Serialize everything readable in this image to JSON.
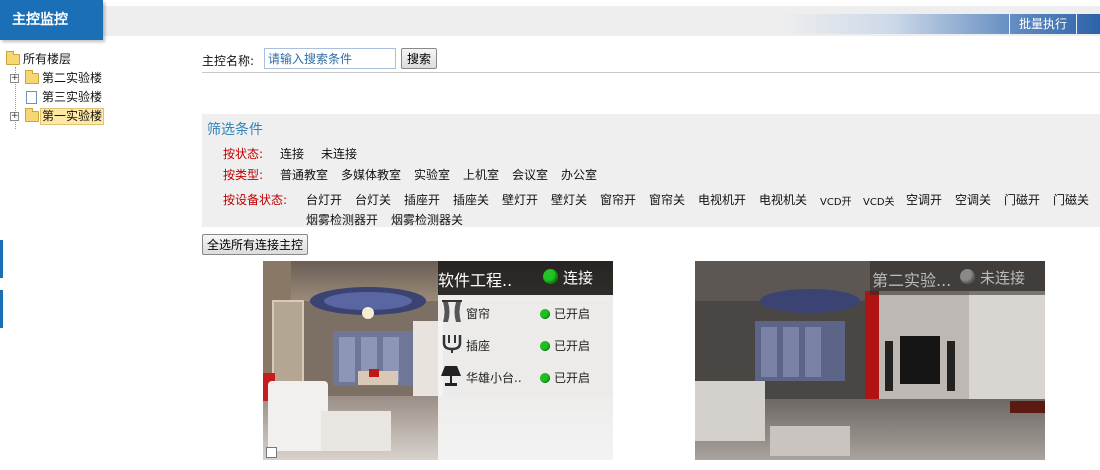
{
  "header": {
    "title": "主控监控",
    "batch_label": "批量执行"
  },
  "tree": {
    "root": "所有楼层",
    "items": [
      {
        "label": "第二实验楼",
        "expandable": true,
        "selected": false
      },
      {
        "label": "第三实验楼",
        "expandable": false,
        "selected": false
      },
      {
        "label": "第一实验楼",
        "expandable": true,
        "selected": true
      }
    ]
  },
  "search": {
    "label": "主控名称:",
    "value": "请输入搜索条件",
    "button": "搜索"
  },
  "filter": {
    "title": "筛选条件",
    "status_label": "按状态:",
    "status_options": [
      "连接",
      "未连接"
    ],
    "type_label": "按类型:",
    "type_options": [
      "普通教室",
      "多媒体教室",
      "实验室",
      "上机室",
      "会议室",
      "办公室"
    ],
    "device_label": "按设备状态:",
    "device_options": [
      "台灯开",
      "台灯关",
      "插座开",
      "插座关",
      "壁灯开",
      "壁灯关",
      "窗帘开",
      "窗帘关",
      "电视机开",
      "电视机关",
      "VCD开",
      "VCD关",
      "空调开",
      "空调关",
      "门磁开",
      "门磁关",
      "烟雾检测器开",
      "烟雾检测器关"
    ]
  },
  "select_all": "全选所有连接主控",
  "cards": [
    {
      "name": "软件工程..",
      "status": "连接",
      "status_color": "#22c322",
      "devices": [
        {
          "icon": "curtain-icon",
          "name": "窗帘",
          "state": "已开启"
        },
        {
          "icon": "socket-icon",
          "name": "插座",
          "state": "已开启"
        },
        {
          "icon": "lamp-icon",
          "name": "华雄小台..",
          "state": "已开启"
        }
      ]
    },
    {
      "name": "第二实验...",
      "status": "未连接",
      "status_color": "#8a8a8a",
      "devices": []
    }
  ]
}
